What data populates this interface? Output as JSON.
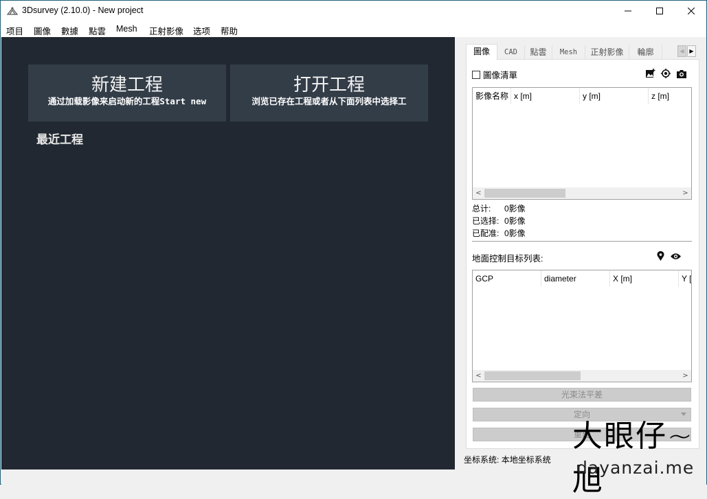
{
  "window": {
    "title": "3Dsurvey (2.10.0) - New project",
    "app_icon": "3dsurvey-logo-icon",
    "controls": [
      "minimize",
      "maximize",
      "close"
    ]
  },
  "menu": {
    "items": [
      {
        "label": "项目"
      },
      {
        "label": "圖像"
      },
      {
        "label": "數據"
      },
      {
        "label": "點雲"
      },
      {
        "label": "Mesh"
      },
      {
        "label": "正射影像"
      },
      {
        "label": "选项"
      },
      {
        "label": "帮助"
      }
    ]
  },
  "start": {
    "new_project": {
      "title": "新建工程",
      "subtitle": "通过加载影像来启动新的工程Start new"
    },
    "open_project": {
      "title": "打开工程",
      "subtitle": "浏览已存在工程或者从下面列表中选择工"
    },
    "recent_title": "最近工程"
  },
  "panel": {
    "tabs": [
      {
        "label": "圖像",
        "active": true
      },
      {
        "label": "CAD"
      },
      {
        "label": "點雲"
      },
      {
        "label": "Mesh"
      },
      {
        "label": "正射影像"
      },
      {
        "label": "輪廓"
      }
    ],
    "image_list_checkbox": "圖像清單",
    "image_list_checked": false,
    "image_icons": [
      "add-image-icon",
      "target-icon",
      "camera-icon"
    ],
    "image_table": {
      "columns": [
        "影像名称",
        "x [m]",
        "y [m]",
        "z [m]"
      ],
      "rows": [],
      "scroll_thumb_fraction": 0.38
    },
    "stats": [
      {
        "label": "总计:",
        "value": "0影像"
      },
      {
        "label": "已选择:",
        "value": "0影像"
      },
      {
        "label": "已配准:",
        "value": "0影像"
      }
    ],
    "gcp_label": "地面控制目标列表:",
    "gcp_icons": [
      "map-marker-icon",
      "eye-icon"
    ],
    "gcp_table": {
      "columns": [
        "GCP",
        "diameter",
        "X [m]",
        "Y ["
      ],
      "rows": [],
      "scroll_thumb_fraction": 0.48
    },
    "buttons": {
      "bundle_adjustment": "光束法平差",
      "orientation": "定向",
      "rebuild": "重建"
    },
    "coordinate_system_label": "坐标系统:",
    "coordinate_system_value": "本地坐标系统"
  },
  "watermark": {
    "cn": "大眼仔~旭",
    "en": "dayanzai.me"
  }
}
